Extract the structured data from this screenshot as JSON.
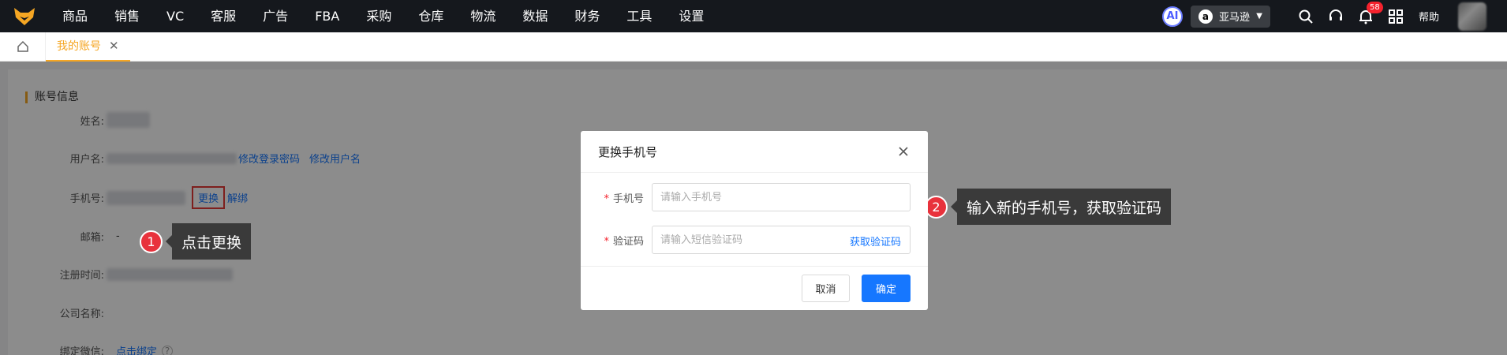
{
  "nav": {
    "items": [
      "商品",
      "销售",
      "VC",
      "客服",
      "广告",
      "FBA",
      "采购",
      "仓库",
      "物流",
      "数据",
      "财务",
      "工具",
      "设置"
    ],
    "ai_label": "AI",
    "store": {
      "icon_letter": "a",
      "name": "亚马逊"
    },
    "notification_count": "58",
    "help": "帮助",
    "colors": {
      "bar": "#15181d",
      "accent": "#f5a623"
    }
  },
  "tabs": {
    "active": "我的账号",
    "close": "✕"
  },
  "account": {
    "section_title": "账号信息",
    "rows": {
      "name": {
        "label": "姓名:"
      },
      "username": {
        "label": "用户名:",
        "link1": "修改登录密码",
        "link2": "修改用户名"
      },
      "phone": {
        "label": "手机号:",
        "change": "更换",
        "unbind": "解绑"
      },
      "email": {
        "label": "邮箱:",
        "value": "-"
      },
      "register_time": {
        "label": "注册时间:"
      },
      "company": {
        "label": "公司名称:"
      },
      "wechat": {
        "label": "绑定微信:",
        "link": "点击绑定"
      }
    }
  },
  "callouts": [
    {
      "num": "1",
      "text": "点击更换"
    },
    {
      "num": "2",
      "text": "输入新的手机号，获取验证码"
    }
  ],
  "modal": {
    "title": "更换手机号",
    "fields": {
      "phone": {
        "required": "*",
        "label": "手机号",
        "placeholder": "请输入手机号"
      },
      "code": {
        "required": "*",
        "label": "验证码",
        "placeholder": "请输入短信验证码",
        "action": "获取验证码"
      }
    },
    "cancel": "取消",
    "confirm": "确定"
  }
}
